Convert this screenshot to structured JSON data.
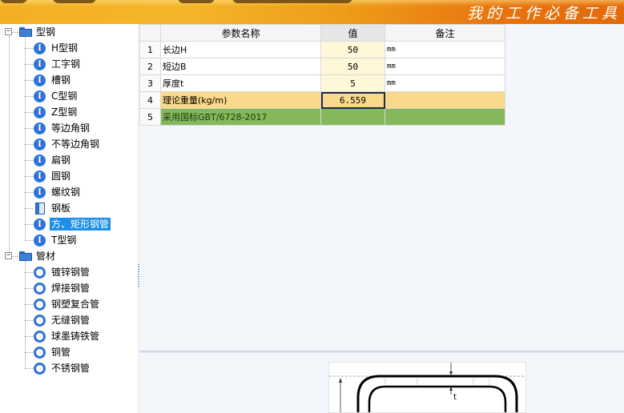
{
  "banner": {
    "slogan": "我的工作必备工具"
  },
  "tree": {
    "groups": [
      {
        "label": "型钢",
        "expander": "−",
        "items": [
          {
            "label": "H型钢",
            "icon": "i-beam-icon"
          },
          {
            "label": "工字钢",
            "icon": "i-beam-icon"
          },
          {
            "label": "槽钢",
            "icon": "i-beam-icon"
          },
          {
            "label": "C型钢",
            "icon": "i-beam-icon"
          },
          {
            "label": "Z型钢",
            "icon": "i-beam-icon"
          },
          {
            "label": "等边角钢",
            "icon": "i-beam-icon"
          },
          {
            "label": "不等边角钢",
            "icon": "i-beam-icon"
          },
          {
            "label": "扁钢",
            "icon": "i-beam-icon"
          },
          {
            "label": "圆钢",
            "icon": "i-beam-icon"
          },
          {
            "label": "螺纹钢",
            "icon": "i-beam-icon"
          },
          {
            "label": "钢板",
            "icon": "plate-icon"
          },
          {
            "label": "方、矩形钢管",
            "icon": "i-beam-icon",
            "selected": true
          },
          {
            "label": "T型钢",
            "icon": "i-beam-icon"
          }
        ]
      },
      {
        "label": "管材",
        "expander": "−",
        "items": [
          {
            "label": "镀锌钢管",
            "icon": "pipe-ring-icon"
          },
          {
            "label": "焊接钢管",
            "icon": "pipe-ring-icon"
          },
          {
            "label": "钢塑复合管",
            "icon": "pipe-ring-icon"
          },
          {
            "label": "无缝钢管",
            "icon": "pipe-ring-icon"
          },
          {
            "label": "球墨铸铁管",
            "icon": "pipe-ring-icon"
          },
          {
            "label": "铜管",
            "icon": "pipe-ring-icon"
          },
          {
            "label": "不锈钢管",
            "icon": "pipe-ring-icon"
          }
        ]
      }
    ]
  },
  "grid": {
    "headers": {
      "name": "参数名称",
      "value": "值",
      "note": "备注"
    },
    "rows": [
      {
        "num": "1",
        "name": "长边H",
        "value": "50",
        "note": "mm"
      },
      {
        "num": "2",
        "name": "短边B",
        "value": "50",
        "note": "mm"
      },
      {
        "num": "3",
        "name": "厚度t",
        "value": "5",
        "note": "mm"
      },
      {
        "num": "4",
        "name": "理论重量(kg/m)",
        "value": "6.559",
        "note": ""
      },
      {
        "num": "5",
        "name": "采用国标GBT/6728-2017",
        "value": "",
        "note": ""
      }
    ]
  },
  "drawing": {
    "thickness_label": "t"
  },
  "colors": {
    "accent": "#2c74d4",
    "selection": "#1c8fe8",
    "value_cell": "#fff8d8",
    "weight_row": "#fbd98a",
    "standard_row": "#84b85a"
  }
}
